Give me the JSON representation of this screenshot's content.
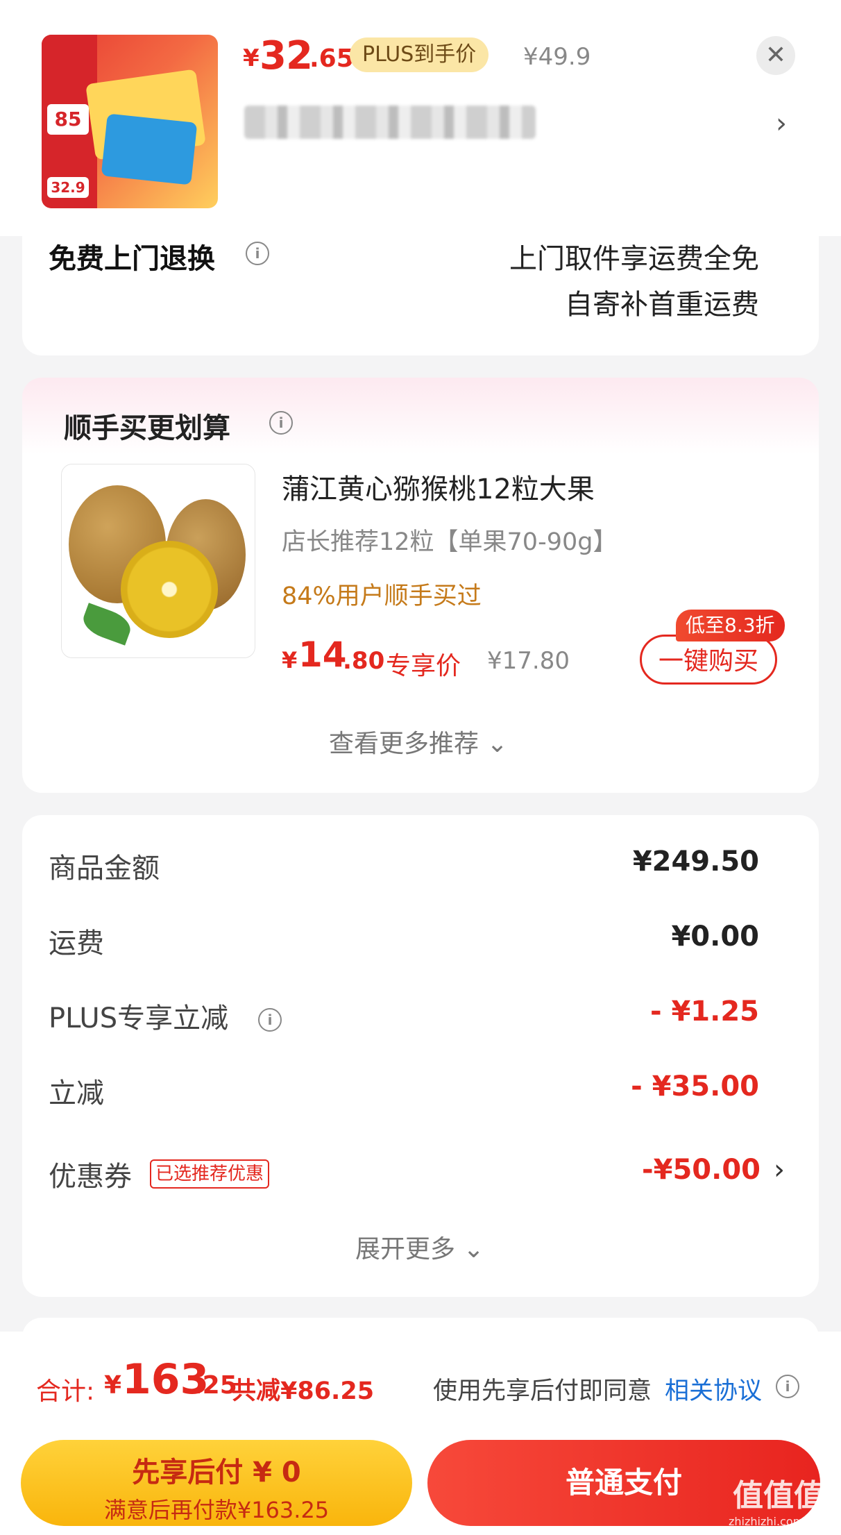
{
  "header": {
    "price_symbol": "¥",
    "price_int": "32",
    "price_dec": ".65",
    "plus_tag": "PLUS到手价",
    "original_price": "¥49.9",
    "close_icon": "✕",
    "chevron": "›",
    "product_image_text": {
      "badge_85": "85",
      "badge_32": "32.9"
    }
  },
  "return_service": {
    "title": "免费上门退换",
    "line1": "上门取件享运费全免",
    "line2": "自寄补首重运费"
  },
  "recommendation": {
    "title": "顺手买更划算",
    "product_name": "蒲江黄心猕猴桃12粒大果",
    "spec": "店长推荐12粒【单果70-90g】",
    "social_proof": "84%用户顺手买过",
    "price_symbol": "¥",
    "price_int": "14",
    "price_dec": ".80",
    "price_tag": "专享价",
    "original_price": "¥17.80",
    "discount_badge": "低至8.3折",
    "buy_button": "一键购买",
    "more": "查看更多推荐 ⌄"
  },
  "summary": {
    "rows": [
      {
        "label": "商品金额",
        "value": "¥249.50"
      },
      {
        "label": "运费",
        "value": "¥0.00"
      },
      {
        "label": "PLUS专享立减",
        "value": "- ¥1.25"
      },
      {
        "label": "立减",
        "value": "- ¥35.00"
      },
      {
        "label": "优惠券",
        "value": "-¥50.00"
      }
    ],
    "coupon_tag": "已选推荐优惠",
    "expand_more": "展开更多 ⌄"
  },
  "bottom": {
    "total_label": "合计:",
    "total_symbol": "¥",
    "total_int": "163",
    "total_dec": ".25",
    "total_saved": "共减¥86.25",
    "agree_text": "使用先享后付即同意",
    "agree_link": "相关协议",
    "bnpl_main": "先享后付 ¥ 0",
    "bnpl_sub": "满意后再付款¥163.25",
    "pay_button": "普通支付",
    "watermark": "值值值",
    "watermark_sub": "zhizhizhi.com"
  },
  "colors": {
    "accent_red": "#e4281f",
    "plus_gold": "#fbe6a6",
    "bnpl_yellow": "#f9b50c",
    "link_blue": "#1a6fd6"
  }
}
